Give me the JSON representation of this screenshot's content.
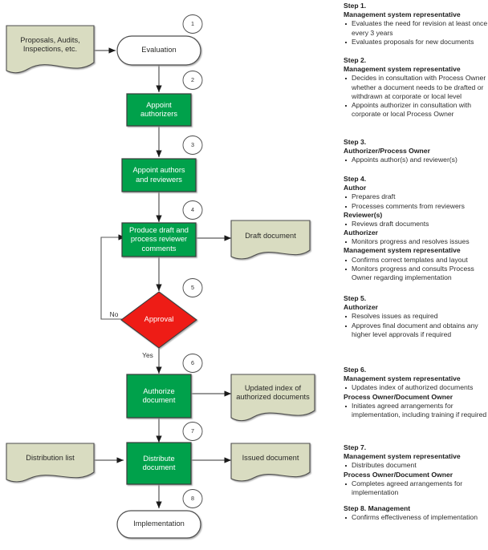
{
  "diagram": {
    "title_hidden": "Document control flowchart",
    "colors": {
      "process_fill": "#00A14B",
      "process_fill_dark": "#009144",
      "document_fill": "#D9DCC1",
      "decision_fill": "#EE1C14",
      "terminator_fill": "#FFFFFF",
      "stroke": "#4d4d4d",
      "connector": "#595959"
    },
    "nodes": [
      {
        "id": "n-proposals",
        "shape": "document",
        "label": "Proposals, Audits,\nInspections, etc."
      },
      {
        "id": "n-evaluation",
        "shape": "terminator",
        "label": "Evaluation",
        "marker": "1"
      },
      {
        "id": "n-appoint-authorizers",
        "shape": "process",
        "label": "Appoint\nauthorizers",
        "marker": "2"
      },
      {
        "id": "n-appoint-authors",
        "shape": "process",
        "label": "Appoint authors\nand reviewers",
        "marker": "3"
      },
      {
        "id": "n-produce-draft",
        "shape": "process",
        "label": "Produce draft and\nprocess reviewer\ncomments",
        "marker": "4"
      },
      {
        "id": "n-draft-document",
        "shape": "document",
        "label": "Draft document"
      },
      {
        "id": "n-approval",
        "shape": "decision",
        "label": "Approval",
        "marker": "5"
      },
      {
        "id": "n-authorize-document",
        "shape": "process",
        "label": "Authorize\ndocument",
        "marker": "6"
      },
      {
        "id": "n-updated-index",
        "shape": "document",
        "label": "Updated index of\nauthorized documents"
      },
      {
        "id": "n-distribution-list",
        "shape": "document",
        "label": "Distribution list"
      },
      {
        "id": "n-distribute-document",
        "shape": "process",
        "label": "Distribute\ndocument",
        "marker": "7"
      },
      {
        "id": "n-issued-document",
        "shape": "document",
        "label": "Issued document"
      },
      {
        "id": "n-implementation",
        "shape": "terminator",
        "label": "Implementation",
        "marker": "8"
      }
    ],
    "edge_labels": {
      "no": "No",
      "yes": "Yes"
    },
    "markers": [
      "1",
      "2",
      "3",
      "4",
      "5",
      "6",
      "7",
      "8"
    ]
  },
  "steps": [
    {
      "title": "Step 1.",
      "groups": [
        {
          "role": "Management system representative",
          "items": [
            "Evaluates the need for revision at least once every 3 years",
            "Evaluates proposals for new documents"
          ]
        }
      ]
    },
    {
      "title": "Step 2.",
      "groups": [
        {
          "role": "Management system representative",
          "items": [
            "Decides in consultation with Process Owner whether a document needs to be drafted or withdrawn at corporate or local level",
            "Appoints authorizer in consultation with corporate or local Process Owner"
          ]
        }
      ]
    },
    {
      "title": "Step 3.",
      "groups": [
        {
          "role": "Authorizer/Process Owner",
          "items": [
            "Appoints author(s) and reviewer(s)"
          ]
        }
      ]
    },
    {
      "title": "Step 4.",
      "groups": [
        {
          "role": "Author",
          "items": [
            "Prepares draft",
            "Processes comments from reviewers"
          ]
        },
        {
          "role": "Reviewer(s)",
          "items": [
            "Reviews draft documents"
          ]
        },
        {
          "role": "Authorizer",
          "items": [
            "Monitors progress and resolves issues"
          ]
        },
        {
          "role": "Management system representative",
          "items": [
            "Confirms correct templates and layout",
            "Monitors progress and consults Process Owner regarding implementation"
          ]
        }
      ]
    },
    {
      "title": "Step 5.",
      "groups": [
        {
          "role": "Authorizer",
          "items": [
            "Resolves issues as required",
            "Approves final document and obtains any higher level approvals if required"
          ]
        }
      ]
    },
    {
      "title": "Step 6.",
      "groups": [
        {
          "role": "Management system representative",
          "items": [
            "Updates index of authorized documents"
          ]
        },
        {
          "role": "Process Owner/Document Owner",
          "items": [
            "Initiates agreed arrangements for implementation, including training if required"
          ]
        }
      ]
    },
    {
      "title": "Step 7.",
      "groups": [
        {
          "role": "Management system representative",
          "items": [
            "Distributes document"
          ]
        },
        {
          "role": "Process Owner/Document Owner",
          "items": [
            "Completes agreed arrangements for implementation"
          ]
        }
      ]
    },
    {
      "title": "Step 8. Management",
      "groups": [
        {
          "role": "",
          "items": [
            "Confirms effectiveness of implementation"
          ]
        }
      ]
    }
  ]
}
